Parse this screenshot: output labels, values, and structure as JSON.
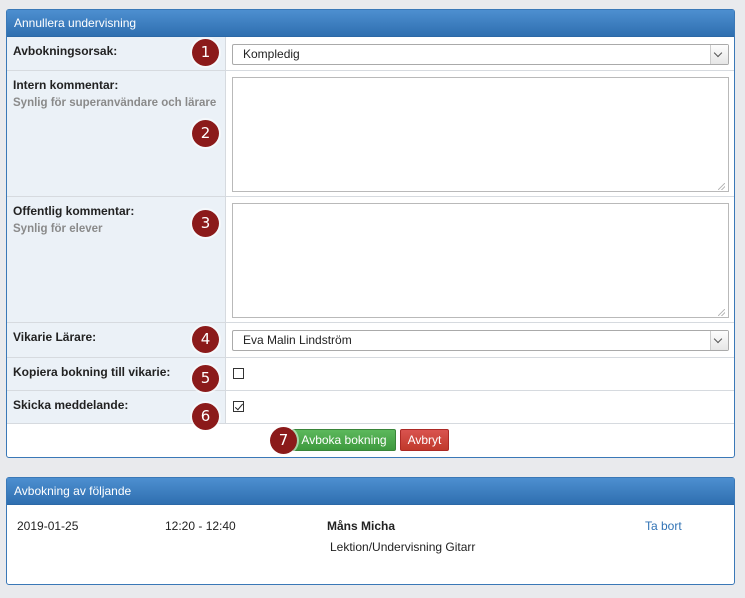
{
  "cancel_panel": {
    "title": "Annullera undervisning",
    "reason": {
      "label": "Avbokningsorsak:",
      "value": "Kompledig"
    },
    "internal_comment": {
      "label": "Intern kommentar:",
      "hint": "Synlig för superanvändare och lärare",
      "value": ""
    },
    "public_comment": {
      "label": "Offentlig kommentar:",
      "hint": "Synlig för elever",
      "value": ""
    },
    "substitute": {
      "label": "Vikarie Lärare:",
      "value": "Eva Malin Lindström"
    },
    "copy_booking": {
      "label": "Kopiera bokning till vikarie:",
      "checked": false
    },
    "send_message": {
      "label": "Skicka meddelande:",
      "checked": true
    },
    "confirm_label": "Avboka bokning",
    "cancel_label": "Avbryt"
  },
  "badges": [
    "1",
    "2",
    "3",
    "4",
    "5",
    "6",
    "7"
  ],
  "list_panel": {
    "title": "Avbokning av följande",
    "rows": [
      {
        "date": "2019-01-25",
        "time": "12:20 - 12:40",
        "name": "Måns Micha",
        "lesson": "Lektion/Undervisning Gitarr",
        "action": "Ta bort"
      }
    ]
  },
  "colors": {
    "header": "#2f6fb0",
    "badge": "#8b1a1a",
    "confirm": "#4cae4c",
    "cancel": "#d9534f",
    "link": "#3173b5"
  }
}
